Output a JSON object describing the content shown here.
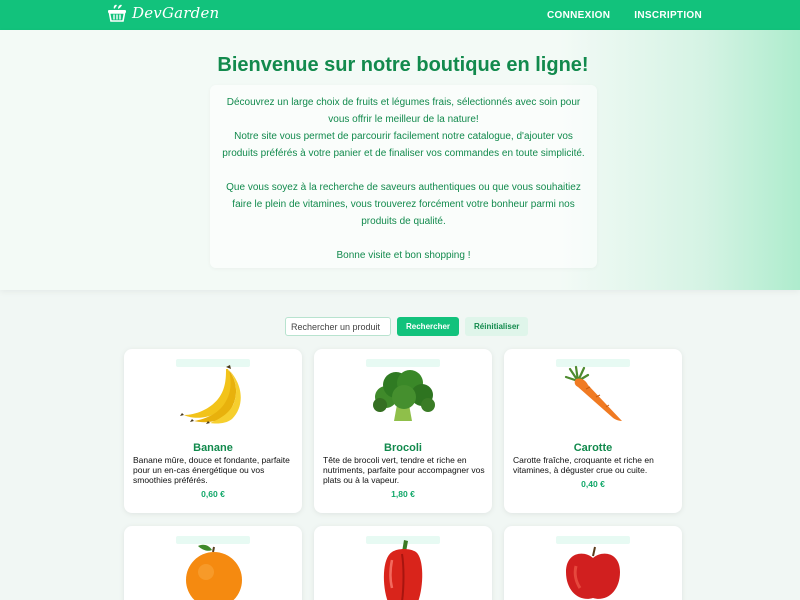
{
  "brand": {
    "name": "DevGarden"
  },
  "nav": {
    "login": "CONNEXION",
    "signup": "INSCRIPTION"
  },
  "hero": {
    "title": "Bienvenue sur notre boutique en ligne!",
    "p1": "Découvrez un large choix de fruits et légumes frais, sélectionnés avec soin pour vous offrir le meilleur de la nature!",
    "p2": "Notre site vous permet de parcourir facilement notre catalogue, d'ajouter vos produits préférés à votre panier et de finaliser vos commandes en toute simplicité.",
    "p3": "Que vous soyez à la recherche de saveurs authentiques ou que vous souhaitiez faire le plein de vitamines, vous trouverez forcément votre bonheur parmi nos produits de qualité.",
    "p4": "Bonne visite et bon shopping !"
  },
  "search": {
    "placeholder": "Rechercher un produit",
    "value": "",
    "search_label": "Rechercher",
    "reset_label": "Réinitialiser"
  },
  "products": [
    {
      "name": "Banane",
      "description": "Banane mûre, douce et fondante, parfaite pour un en-cas énergétique ou vos smoothies préférés.",
      "price": "0,60 €",
      "icon": "banana-icon"
    },
    {
      "name": "Brocoli",
      "description": "Tête de brocoli vert, tendre et riche en nutriments, parfaite pour accompagner vos plats ou à la vapeur.",
      "price": "1,80 €",
      "icon": "broccoli-icon"
    },
    {
      "name": "Carotte",
      "description": "Carotte fraîche, croquante et riche en vitamines, à déguster crue ou cuite.",
      "price": "0,40 €",
      "icon": "carrot-icon"
    },
    {
      "name": "",
      "description": "",
      "price": "",
      "icon": "orange-icon"
    },
    {
      "name": "",
      "description": "",
      "price": "",
      "icon": "bell-pepper-icon"
    },
    {
      "name": "",
      "description": "",
      "price": "",
      "icon": "apple-icon"
    }
  ],
  "colors": {
    "primary": "#12c27c",
    "text_green": "#128a4d",
    "background": "#f1f7f4"
  }
}
